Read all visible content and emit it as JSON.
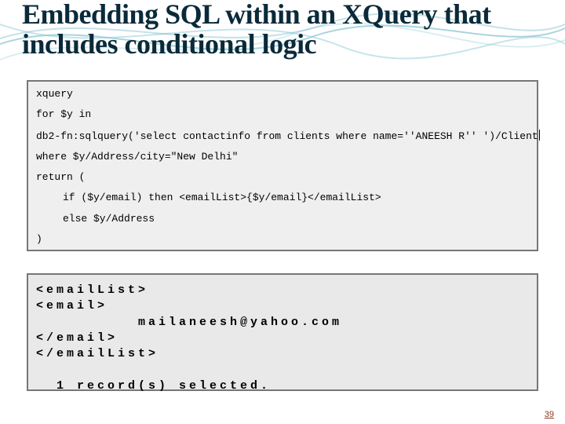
{
  "title": "Embedding SQL within an XQuery that includes conditional logic",
  "code1": {
    "l0": "xquery",
    "l1": "for $y in",
    "l2": "db2-fn:sqlquery('select contactinfo from clients where name=''ANEESH R'' ')/Client",
    "l3": "where $y/Address/city=\"New Delhi\"",
    "l4": "return (",
    "l5": "if ($y/email) then <emailList>{$y/email}</emailList>",
    "l6": "else $y/Address",
    "l7": ")"
  },
  "code2": {
    "l0": "<emailList>",
    "l1": "<email>",
    "l2": "          mailaneesh@yahoo.com",
    "l3": "</email>",
    "l4": "</emailList>",
    "l5": "",
    "l6": "  1 record(s) selected."
  },
  "page_number": "39"
}
